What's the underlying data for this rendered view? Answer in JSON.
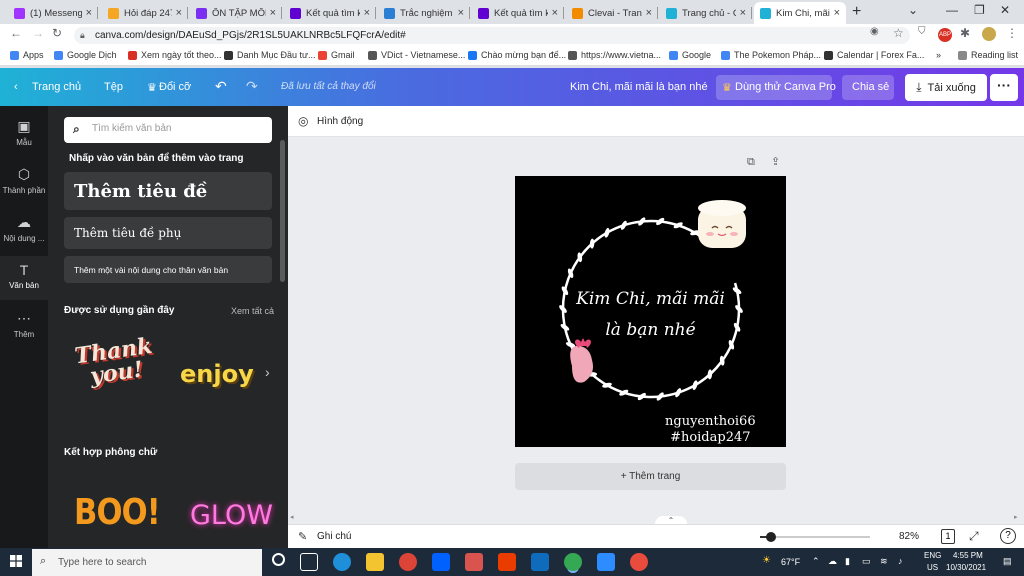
{
  "browser": {
    "tabs": [
      {
        "title": "(1) Messenger",
        "color": "#a033ff"
      },
      {
        "title": "Hỏi đáp 247 -",
        "color": "#f5a623"
      },
      {
        "title": "ÔN TẬP MÔN",
        "color": "#7b2ff2"
      },
      {
        "title": "Kết quả tìm ki",
        "color": "#6001d2"
      },
      {
        "title": "Trắc nghiệm C",
        "color": "#2a7fd4"
      },
      {
        "title": "Kết quả tìm ki",
        "color": "#6001d2"
      },
      {
        "title": "Clevai - Trang",
        "color": "#f28b00"
      },
      {
        "title": "Trang chủ - C",
        "color": "#1fb2d6"
      },
      {
        "title": "Kim Chi, mãi m",
        "color": "#1fb2d6"
      }
    ],
    "url": "canva.com/design/DAEuSd_PGjs/2R1SL5UAKLNRBc5LFQFcrA/edit#",
    "bookmarks": [
      {
        "label": "Apps",
        "color": "#4285f4"
      },
      {
        "label": "Google Dịch",
        "color": "#4285f4"
      },
      {
        "label": "Xem ngày tốt theo...",
        "color": "#d93025"
      },
      {
        "label": "Danh Mục Đầu tư...",
        "color": "#333333"
      },
      {
        "label": "Gmail",
        "color": "#ea4335"
      },
      {
        "label": "VDict - Vietnamese...",
        "color": "#555555"
      },
      {
        "label": "Chào mừng bạn đế...",
        "color": "#1877f2"
      },
      {
        "label": "https://www.vietna...",
        "color": "#555555"
      },
      {
        "label": "Google",
        "color": "#4285f4"
      },
      {
        "label": "The Pokemon Pháp...",
        "color": "#4285f4"
      },
      {
        "label": "Calendar | Forex Fa...",
        "color": "#333333"
      }
    ],
    "reading_list": "Reading list",
    "more_bookmarks": "»"
  },
  "canva_top": {
    "home": "Trang chủ",
    "file": "Tệp",
    "resize": "Đổi cỡ",
    "saved_status": "Đã lưu tất cả thay đổi",
    "design_title": "Kim Chi, mãi mãi là bạn nhé",
    "pro_button": "Dùng thử Canva Pro",
    "share_button": "Chia sẻ",
    "download_button": "Tải xuống"
  },
  "rail": [
    {
      "label": "Mẫu",
      "icon": "template-icon"
    },
    {
      "label": "Thành phần",
      "icon": "elements-icon"
    },
    {
      "label": "Nội dung ...",
      "icon": "upload-icon"
    },
    {
      "label": "Văn bản",
      "icon": "text-icon"
    },
    {
      "label": "Thêm",
      "icon": "more-icon"
    }
  ],
  "panel": {
    "search_placeholder": "Tìm kiếm văn bản",
    "instruction": "Nhấp vào văn bản để thêm vào trang",
    "heading_box": "Thêm tiêu đề",
    "subheading_box": "Thêm tiêu đề phụ",
    "body_box": "Thêm một vài nội dung cho thân văn bản",
    "recent_title": "Được sử dụng gần đây",
    "see_all": "Xem tất cả",
    "recent_items": [
      "Thank you!",
      "enjoy"
    ],
    "combo_title": "Kết hợp phông chữ",
    "combo_items": [
      "BOO!",
      "GLOW"
    ]
  },
  "workspace": {
    "animate": "Hình động",
    "design_text": [
      "Kim Chi, mãi mãi",
      "là bạn nhé"
    ],
    "watermark": [
      "nguyenthoi66",
      "#hoidap247"
    ],
    "add_page": "+ Thêm trang"
  },
  "bottom_bar": {
    "notes": "Ghi chú",
    "zoom": "82%",
    "zoom_level": 0.82,
    "page_count": "1",
    "help": "?"
  },
  "taskbar": {
    "search_placeholder": "Type here to search",
    "weather": "67°F",
    "lang": "ENG",
    "region": "US",
    "time": "4:55 PM",
    "date": "10/30/2021"
  }
}
